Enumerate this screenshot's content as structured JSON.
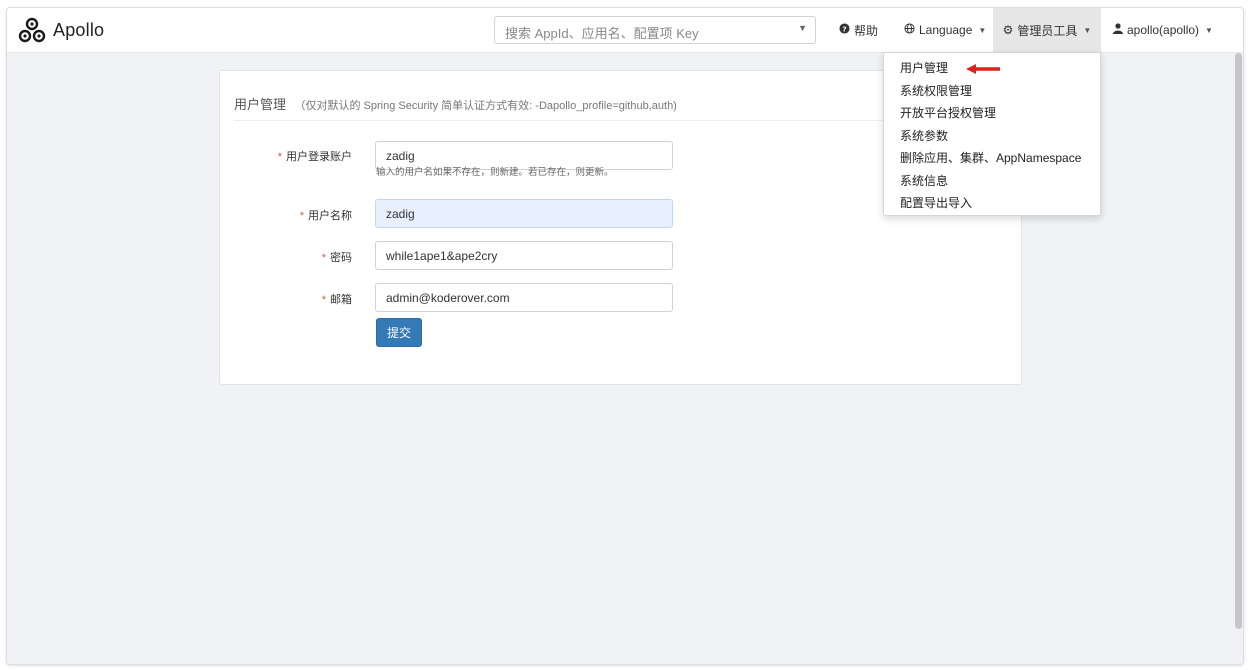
{
  "app": {
    "name": "Apollo",
    "logo_icon": "apollo-logo-icon"
  },
  "search": {
    "placeholder": "搜索 AppId、应用名、配置项 Key"
  },
  "nav": {
    "help": {
      "label": "帮助",
      "icon": "question-circle-icon"
    },
    "language": {
      "label": "Language",
      "icon": "globe-icon"
    },
    "admin_tools": {
      "label": "管理员工具",
      "icon": "gear-icon"
    },
    "user": {
      "label": "apollo(apollo)",
      "icon": "user-icon"
    }
  },
  "admin_menu": {
    "items": [
      "用户管理",
      "系统权限管理",
      "开放平台授权管理",
      "系统参数",
      "删除应用、集群、AppNamespace",
      "系统信息",
      "配置导出导入"
    ],
    "highlight_color": "#d9231c"
  },
  "panel": {
    "title": "用户管理",
    "subtitle": "（仅对默认的 Spring Security 简单认证方式有效: -Dapollo_profile=github,auth)"
  },
  "form": {
    "required_mark": "*",
    "username": {
      "label": "用户登录账户",
      "value": "zadig",
      "help": "输入的用户名如果不存在，则新建。若已存在，则更新。"
    },
    "display_name": {
      "label": "用户名称",
      "value": "zadig"
    },
    "password": {
      "label": "密码",
      "value": "while1ape1&ape2cry"
    },
    "email": {
      "label": "邮箱",
      "value": "admin@koderover.com"
    },
    "submit_label": "提交"
  },
  "colors": {
    "primary": "#337ab7",
    "required": "#d9534f",
    "background": "#f1f2f5"
  }
}
